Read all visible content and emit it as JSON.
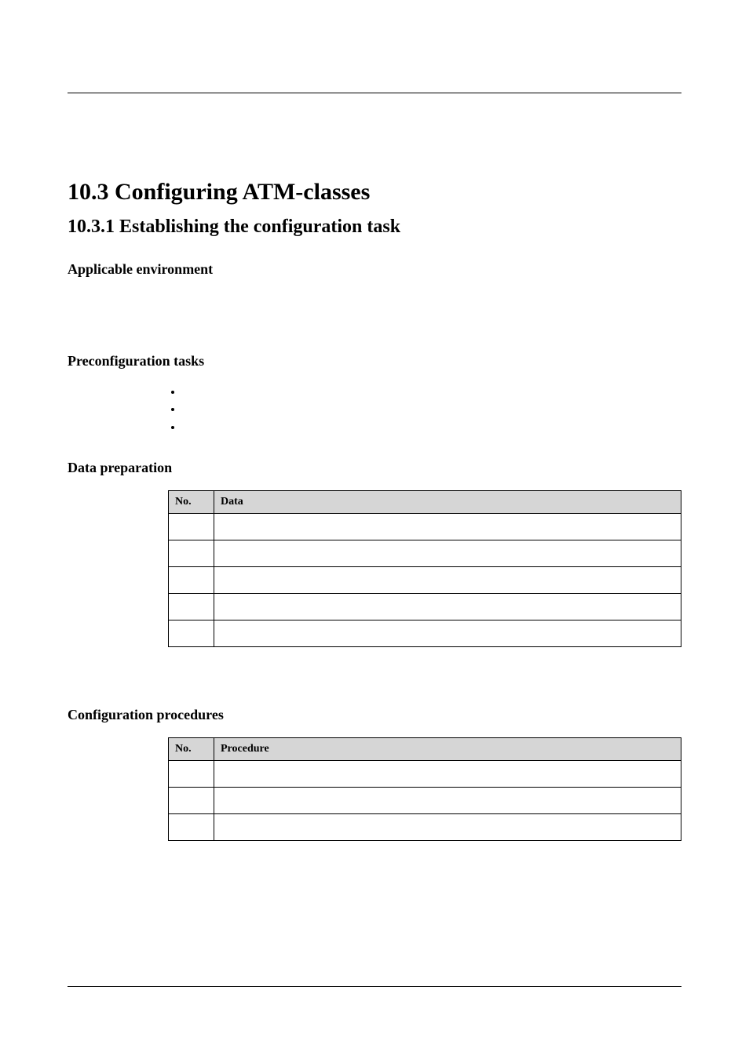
{
  "section": {
    "title": "10.3 Configuring ATM-classes",
    "subsection_title": "10.3.1 Establishing the configuration task",
    "applicable_env_heading": "Applicable environment",
    "preconfig_heading": "Preconfiguration tasks",
    "data_prep_heading": "Data preparation",
    "config_proc_heading": "Configuration procedures"
  },
  "bullets": [
    "",
    "",
    ""
  ],
  "data_table": {
    "headers": {
      "no": "No.",
      "data": "Data"
    },
    "rows": [
      {
        "no": "",
        "data": ""
      },
      {
        "no": "",
        "data": ""
      },
      {
        "no": "",
        "data": ""
      },
      {
        "no": "",
        "data": ""
      },
      {
        "no": "",
        "data": ""
      }
    ]
  },
  "proc_table": {
    "headers": {
      "no": "No.",
      "procedure": "Procedure"
    },
    "rows": [
      {
        "no": "",
        "procedure": ""
      },
      {
        "no": "",
        "procedure": ""
      },
      {
        "no": "",
        "procedure": ""
      }
    ]
  }
}
